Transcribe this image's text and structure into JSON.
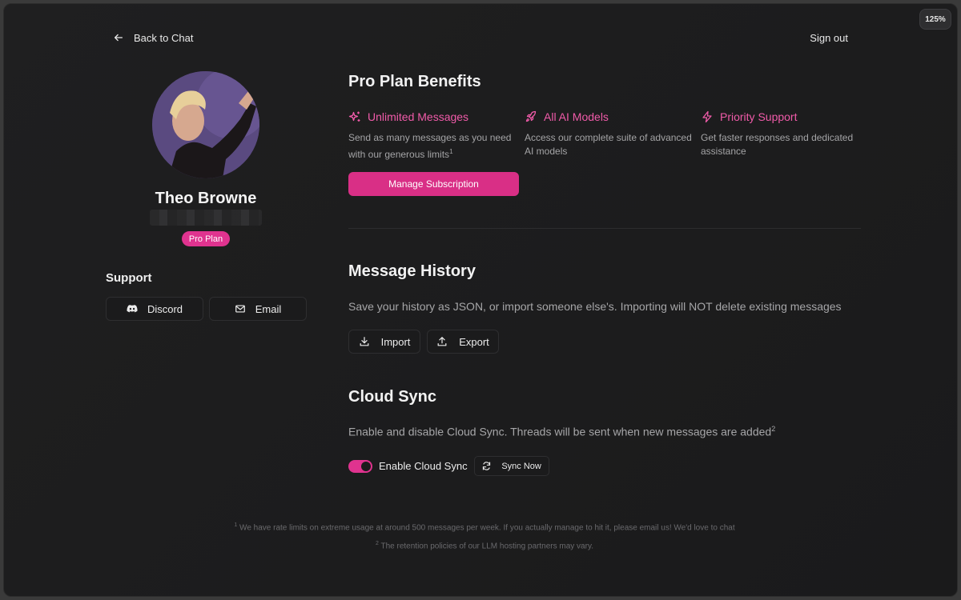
{
  "zoom_level": "125%",
  "topbar": {
    "back_label": "Back to Chat",
    "signout_label": "Sign out"
  },
  "profile": {
    "name": "Theo Browne",
    "plan_badge": "Pro Plan"
  },
  "support": {
    "title": "Support",
    "discord_label": "Discord",
    "email_label": "Email"
  },
  "benefits": {
    "title": "Pro Plan Benefits",
    "items": [
      {
        "icon": "sparkles-icon",
        "title": "Unlimited Messages",
        "desc": "Send as many messages as you need with our generous limits",
        "footnote": "1"
      },
      {
        "icon": "rocket-icon",
        "title": "All AI Models",
        "desc": "Access our complete suite of advanced AI models",
        "footnote": ""
      },
      {
        "icon": "lightning-icon",
        "title": "Priority Support",
        "desc": "Get faster responses and dedicated assistance",
        "footnote": ""
      }
    ],
    "manage_label": "Manage Subscription"
  },
  "history": {
    "title": "Message History",
    "desc": "Save your history as JSON, or import someone else's. Importing will NOT delete existing messages",
    "import_label": "Import",
    "export_label": "Export"
  },
  "cloud_sync": {
    "title": "Cloud Sync",
    "desc": "Enable and disable Cloud Sync. Threads will be sent when new messages are added",
    "footnote": "2",
    "toggle_label": "Enable Cloud Sync",
    "toggle_on": true,
    "sync_now_label": "Sync Now"
  },
  "footnotes": {
    "n1": "1",
    "t1": " We have rate limits on extreme usage at around 500 messages per week. If you actually manage to hit it, please email us! We'd love to chat",
    "n2": "2",
    "t2": " The retention policies of our LLM hosting partners may vary."
  },
  "colors": {
    "accent": "#e0338f",
    "accent_text": "#f05ba9",
    "background": "#1d1d1e"
  }
}
